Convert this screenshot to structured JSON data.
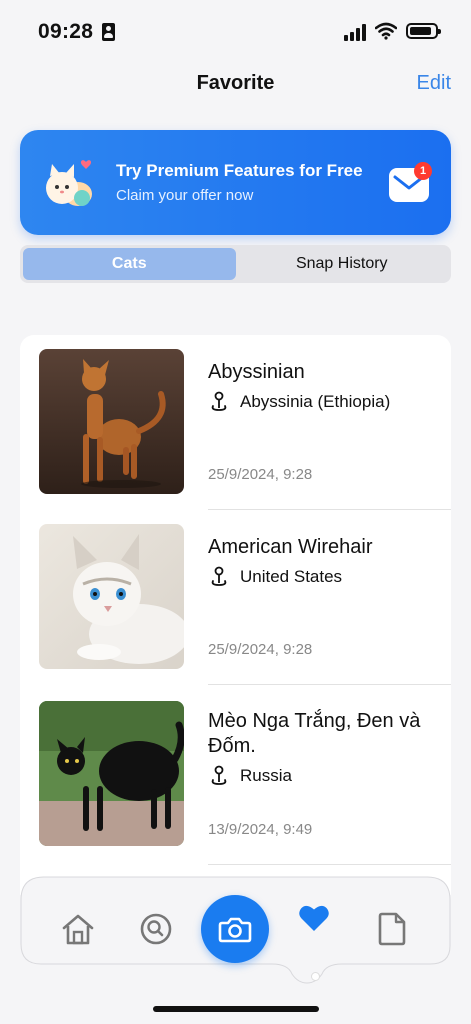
{
  "status_bar": {
    "time": "09:28"
  },
  "header": {
    "title": "Favorite",
    "edit_label": "Edit"
  },
  "banner": {
    "title": "Try Premium Features for Free",
    "subtitle": "Claim your offer now",
    "notification_count": "1"
  },
  "segment": {
    "tabs": [
      {
        "label": "Cats",
        "active": true
      },
      {
        "label": "Snap History",
        "active": false
      }
    ]
  },
  "favorites": [
    {
      "name": "Abyssinian",
      "origin": "Abyssinia (Ethiopia)",
      "date": "25/9/2024, 9:28"
    },
    {
      "name": "American Wirehair",
      "origin": "United States",
      "date": "25/9/2024, 9:28"
    },
    {
      "name": "Mèo Nga Trắng, Đen và Đốm.",
      "origin": "Russia",
      "date": "13/9/2024, 9:49"
    }
  ],
  "bottom_nav": {
    "items": [
      {
        "icon": "home-icon"
      },
      {
        "icon": "search-icon"
      },
      {
        "icon": "camera-icon"
      },
      {
        "icon": "heart-icon",
        "active": true
      },
      {
        "icon": "document-icon"
      }
    ]
  },
  "colors": {
    "accent": "#1a7cf0",
    "banner": "#2e86f0",
    "segment_active": "#96b8ec",
    "notification": "#ff3b30"
  }
}
